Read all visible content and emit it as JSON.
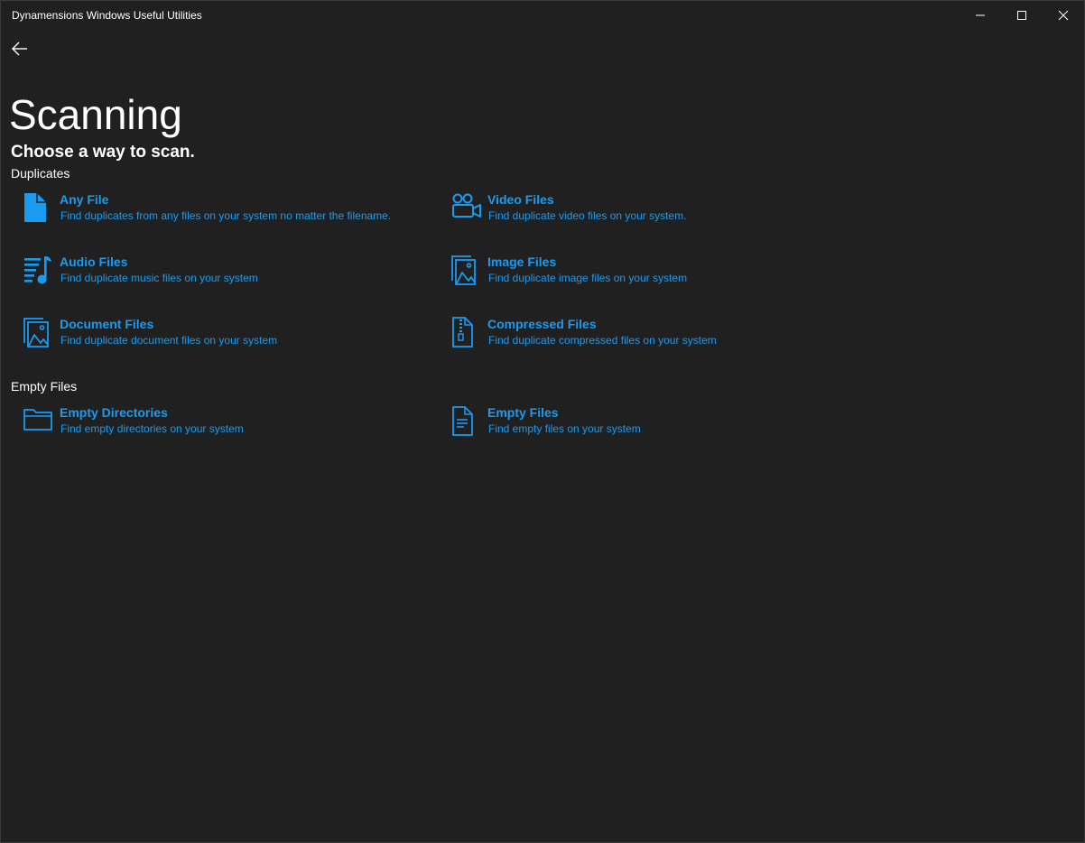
{
  "window": {
    "title": "Dynamensions Windows Useful Utilities",
    "controls": {
      "minimize": "minimize-icon",
      "maximize": "maximize-icon",
      "close": "close-icon"
    }
  },
  "nav": {
    "back": "back-arrow-icon"
  },
  "page": {
    "title": "Scanning",
    "subtitle": "Choose a way to scan."
  },
  "accent_color": "#1a9bf2",
  "sections": {
    "duplicates": {
      "header": "Duplicates",
      "items": [
        {
          "label": "Any File",
          "description": "Find duplicates from any files on your system no matter the filename.",
          "icon": "file-icon"
        },
        {
          "label": "Video Files",
          "description": "Find duplicate video files on your system.",
          "icon": "video-camera-icon"
        },
        {
          "label": "Audio Files",
          "description": "Find duplicate music files on your system",
          "icon": "music-list-icon"
        },
        {
          "label": "Image Files",
          "description": "Find duplicate image files on your system",
          "icon": "image-icon"
        },
        {
          "label": "Document Files",
          "description": "Find duplicate document files on your system",
          "icon": "document-image-icon"
        },
        {
          "label": "Compressed Files",
          "description": "Find duplicate compressed files on your system",
          "icon": "zip-file-icon"
        }
      ]
    },
    "empty": {
      "header": "Empty Files",
      "items": [
        {
          "label": "Empty Directories",
          "description": "Find empty directories on your system",
          "icon": "folder-icon"
        },
        {
          "label": "Empty Files",
          "description": "Find empty files on your system",
          "icon": "text-document-icon"
        }
      ]
    }
  }
}
